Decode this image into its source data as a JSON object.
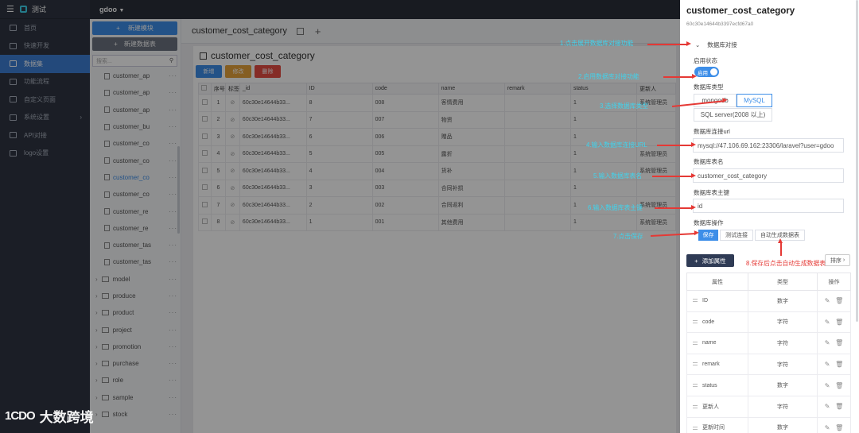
{
  "app": {
    "name": "测试",
    "project": "gdoo"
  },
  "sidebar": {
    "items": [
      {
        "label": "首页"
      },
      {
        "label": "快速开发"
      },
      {
        "label": "数据集",
        "active": true
      },
      {
        "label": "功能流程"
      },
      {
        "label": "自定义页面"
      },
      {
        "label": "系统设置"
      },
      {
        "label": "API对接"
      },
      {
        "label": "logo设置"
      }
    ]
  },
  "tree": {
    "new_module": "新建模块",
    "new_table": "新建数据表",
    "search_placeholder": "搜索...",
    "files": [
      "customer_ap",
      "customer_ap",
      "customer_ap",
      "customer_bu",
      "customer_co",
      "customer_co",
      "customer_co",
      "customer_co",
      "customer_re",
      "customer_re",
      "customer_tas",
      "customer_tas"
    ],
    "folders": [
      "model",
      "produce",
      "product",
      "project",
      "promotion",
      "purchase",
      "role",
      "sample",
      "stock"
    ]
  },
  "main": {
    "tab": "customer_cost_category",
    "title": "customer_cost_category",
    "buttons": {
      "add": "新增",
      "edit": "修改",
      "delete": "删除"
    },
    "columns": [
      "序号",
      "标签",
      "_id",
      "ID",
      "code",
      "name",
      "remark",
      "status",
      "更新人"
    ],
    "rows": [
      {
        "idx": "1",
        "oid": "60c30e14644b33...",
        "id": "8",
        "code": "008",
        "name": "客情费用",
        "remark": "",
        "status": "1",
        "upd": "系统管理员"
      },
      {
        "idx": "2",
        "oid": "60c30e14644b33...",
        "id": "7",
        "code": "007",
        "name": "物资",
        "remark": "",
        "status": "1",
        "upd": ""
      },
      {
        "idx": "3",
        "oid": "60c30e14644b33...",
        "id": "6",
        "code": "006",
        "name": "赠品",
        "remark": "",
        "status": "1",
        "upd": ""
      },
      {
        "idx": "4",
        "oid": "60c30e14644b33...",
        "id": "5",
        "code": "005",
        "name": "露折",
        "remark": "",
        "status": "1",
        "upd": "系统管理员"
      },
      {
        "idx": "5",
        "oid": "60c30e14644b33...",
        "id": "4",
        "code": "004",
        "name": "货补",
        "remark": "",
        "status": "1",
        "upd": "系统管理员"
      },
      {
        "idx": "6",
        "oid": "60c30e14644b33...",
        "id": "3",
        "code": "003",
        "name": "合同补损",
        "remark": "",
        "status": "1",
        "upd": ""
      },
      {
        "idx": "7",
        "oid": "60c30e14644b33...",
        "id": "2",
        "code": "002",
        "name": "合同返利",
        "remark": "",
        "status": "1",
        "upd": "系统管理员"
      },
      {
        "idx": "8",
        "oid": "60c30e14644b33...",
        "id": "1",
        "code": "001",
        "name": "其他费用",
        "remark": "",
        "status": "1",
        "upd": "系统管理员"
      }
    ]
  },
  "drawer": {
    "title": "customer_cost_category",
    "subtitle": "60c30e14644b3397ecfd67a0",
    "section": "数据库对接",
    "enable_label": "启用状态",
    "enable_value": "启用",
    "dbtype_label": "数据库类型",
    "dbtypes": [
      "mongodb",
      "MySQL",
      "SQL server(2008 以上)"
    ],
    "url_label": "数据库连接url",
    "url_value": "mysql://47.106.69.162:23306/laravel?user=gdoo",
    "table_label": "数据库表名",
    "table_value": "customer_cost_category",
    "pk_label": "数据库表主键",
    "pk_value": "id",
    "ops_label": "数据库操作",
    "ops": {
      "save": "保存",
      "test": "测试连接",
      "auto": "自动生成数据表"
    },
    "add_attr": "添加属性",
    "sort": "排序",
    "attr_columns": [
      "属性",
      "类型",
      "操作"
    ],
    "attrs": [
      {
        "name": "ID",
        "type": "数字"
      },
      {
        "name": "code",
        "type": "字符"
      },
      {
        "name": "name",
        "type": "字符"
      },
      {
        "name": "remark",
        "type": "字符"
      },
      {
        "name": "status",
        "type": "数字"
      },
      {
        "name": "更新人",
        "type": "字符"
      },
      {
        "name": "更新时间",
        "type": "数字"
      }
    ]
  },
  "annotations": [
    "1.点击展开数据库对接功能",
    "2.启用数据库对接功能",
    "3.选择数据库类型",
    "4.输入数据库连接URL",
    "5.输入数据库表名",
    "6.输入数据库表主键",
    "7.点击保存",
    "8.保存后点击自动生成数据表"
  ],
  "watermark": {
    "logo": "1CDO",
    "text": "大数跨境"
  },
  "colors": {
    "accent": "#3d8ee8",
    "sidebar": "#2f3542",
    "annotation": "#3fd4ee",
    "arrow": "#e53935"
  }
}
